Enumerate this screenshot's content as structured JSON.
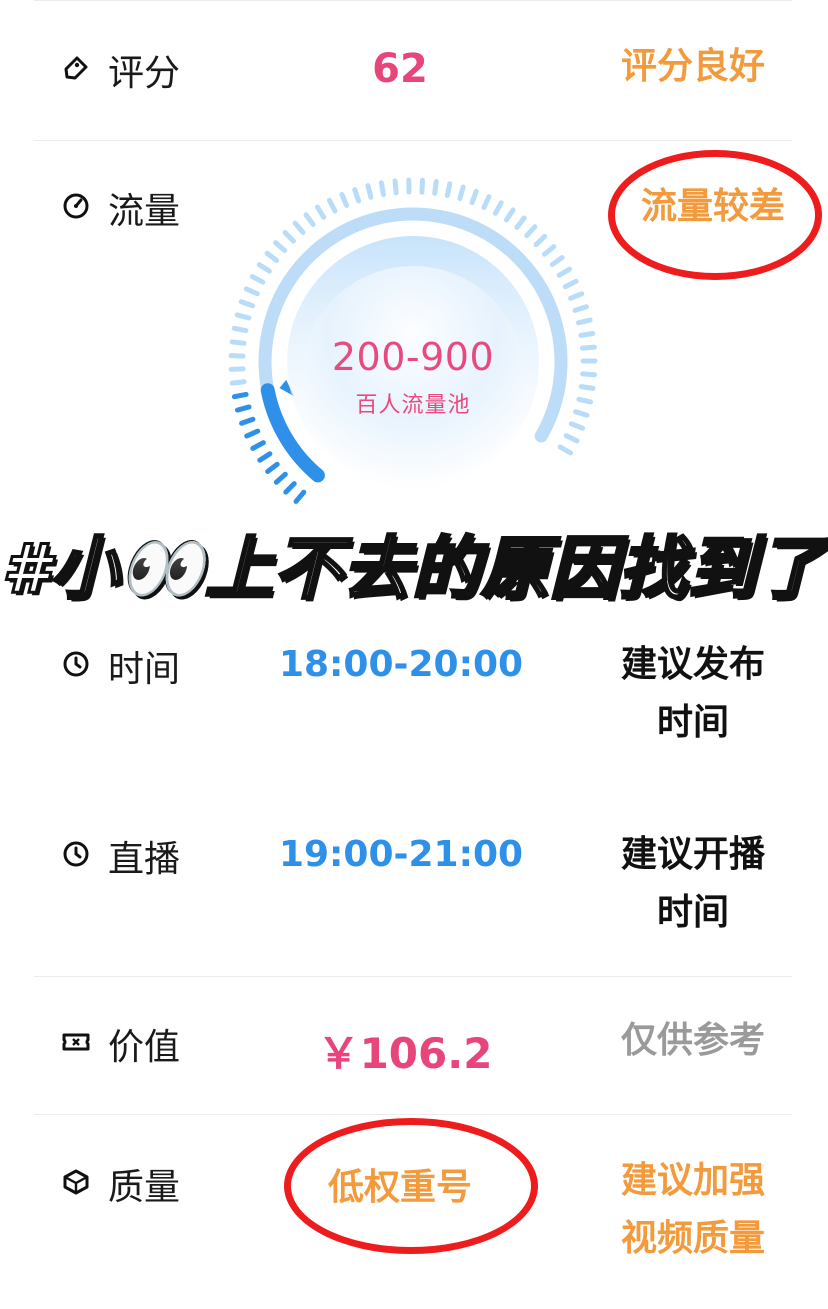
{
  "rows": {
    "score": {
      "label": "评分",
      "value": "62",
      "status": "评分良好",
      "icon": "tag-icon"
    },
    "traffic": {
      "label": "流量",
      "status": "流量较差",
      "icon": "gauge-icon"
    },
    "time": {
      "label": "时间",
      "value": "18:00-20:00",
      "status": "建议发布时间",
      "icon": "clock-icon"
    },
    "live": {
      "label": "直播",
      "value": "19:00-21:00",
      "status": "建议开播时间",
      "icon": "clock-icon"
    },
    "value": {
      "label": "价值",
      "value": "￥106.2",
      "status": "仅供参考",
      "icon": "ticket-icon"
    },
    "quality": {
      "label": "质量",
      "value": "低权重号",
      "status": "建议加强视频质量",
      "icon": "cube-icon"
    }
  },
  "gauge": {
    "main": "200-900",
    "sub": "百人流量池",
    "level": 0.15
  },
  "overlay": {
    "text": "#小👀上不去的原因找到了"
  },
  "colors": {
    "orange": "#f29a3c",
    "blue": "#2e90e8",
    "pink": "#e8457a",
    "gray": "#9a9a9a",
    "red_annotation": "#ee1c1c"
  }
}
